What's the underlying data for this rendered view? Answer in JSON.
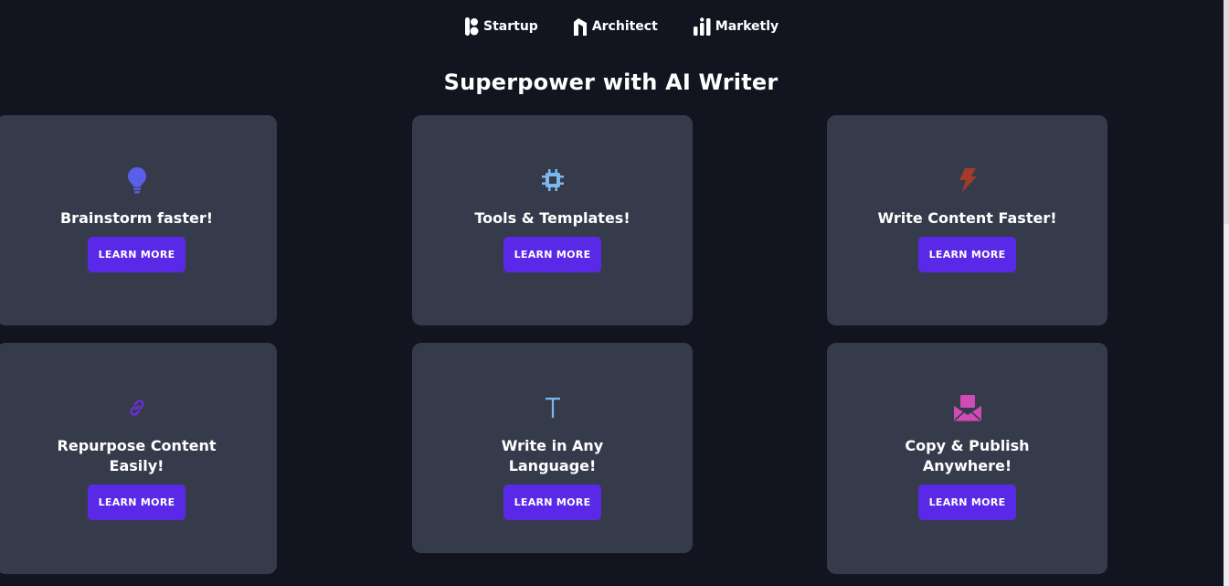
{
  "logos": [
    {
      "label": "Startup",
      "icon": "startup-logo-icon"
    },
    {
      "label": "Architect",
      "icon": "architect-logo-icon"
    },
    {
      "label": "Marketly",
      "icon": "marketly-logo-icon"
    }
  ],
  "section": {
    "title": "Superpower with AI Writer"
  },
  "cards": [
    {
      "title": "Brainstorm faster!",
      "icon": "lightbulb-icon",
      "icon_color": "#5a5ee8",
      "button": "LEARN MORE"
    },
    {
      "title": "Tools & Templates!",
      "icon": "chip-icon",
      "icon_color": "#7cb8ee",
      "button": "LEARN MORE"
    },
    {
      "title": "Write Content Faster!",
      "icon": "lightning-icon",
      "icon_color": "#a33a2c",
      "button": "LEARN MORE"
    },
    {
      "title": "Repurpose Content Easily!",
      "icon": "link-icon",
      "icon_color": "#6a2fd6",
      "button": "LEARN MORE"
    },
    {
      "title": "Write in Any Language!",
      "icon": "text-icon",
      "icon_color": "#7cb8ee",
      "button": "LEARN MORE"
    },
    {
      "title": "Copy & Publish Anywhere!",
      "icon": "envelope-icon",
      "icon_color": "#d04cb4",
      "button": "LEARN MORE"
    }
  ],
  "colors": {
    "background": "#121420",
    "card": "#363b4c",
    "accent": "#5a29e7"
  }
}
